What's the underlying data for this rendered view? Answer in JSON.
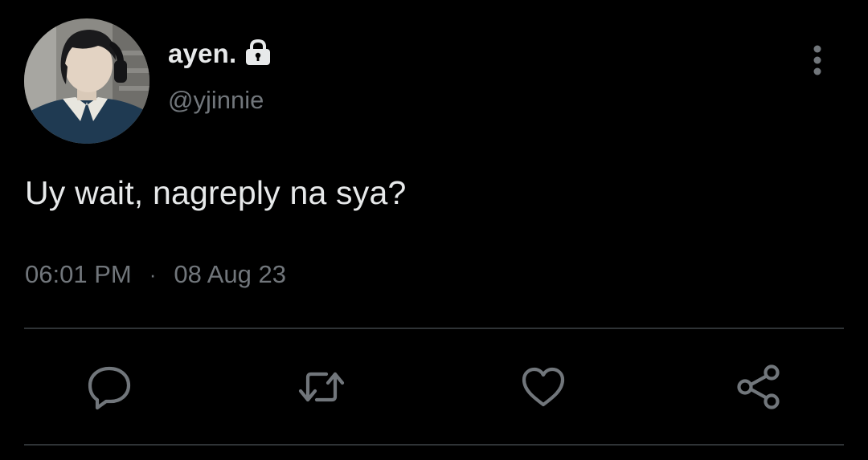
{
  "tweet": {
    "author": {
      "display_name": "ayen.",
      "handle": "@yjinnie",
      "protected_icon": "lock-icon",
      "avatar": "profile-photo"
    },
    "text": "Uy wait, nagreply na sya?",
    "time": "06:01 PM",
    "separator": "·",
    "date": "08 Aug 23",
    "menu_icon": "more-vertical-icon",
    "actions": [
      "reply-icon",
      "retweet-icon",
      "like-icon",
      "share-icon"
    ]
  },
  "colors": {
    "background": "#000000",
    "primary_text": "#e7e9ea",
    "secondary_text": "#71767b",
    "divider": "#2f3336"
  }
}
